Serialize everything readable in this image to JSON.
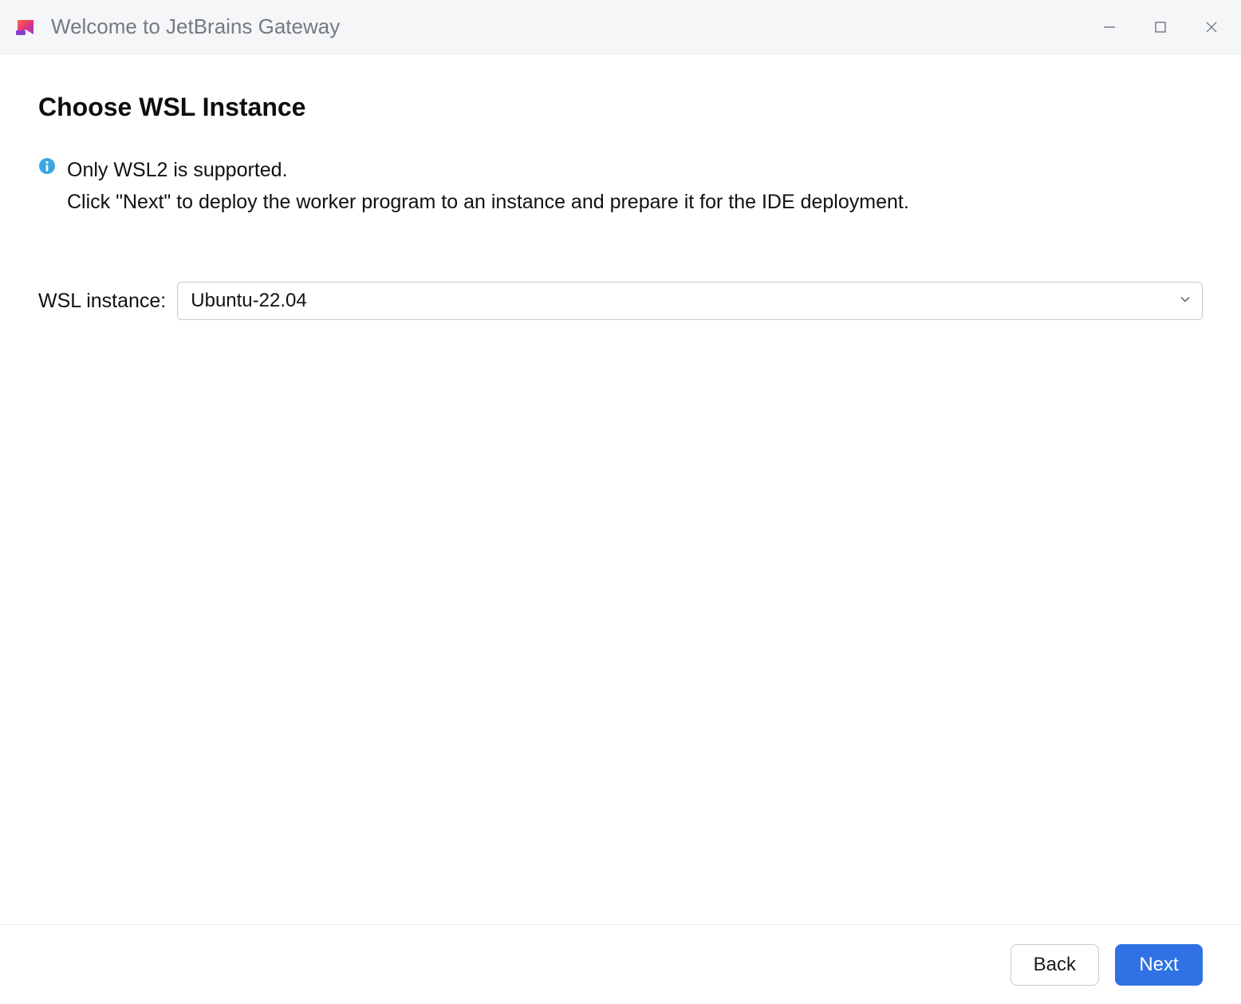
{
  "titlebar": {
    "title": "Welcome to JetBrains Gateway"
  },
  "main": {
    "heading": "Choose WSL Instance",
    "info_line1": "Only WSL2 is supported.",
    "info_line2": "Click \"Next\" to deploy the worker program to an instance and prepare it for the IDE deployment."
  },
  "form": {
    "wsl_instance_label": "WSL instance:",
    "wsl_instance_value": "Ubuntu-22.04"
  },
  "footer": {
    "back_label": "Back",
    "next_label": "Next"
  }
}
